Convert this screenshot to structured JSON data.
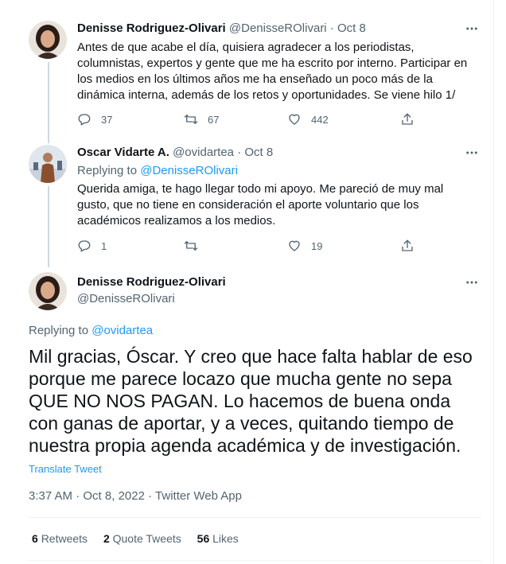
{
  "tweet1": {
    "name": "Denisse Rodriguez-Olivari",
    "handle": "@DenisseROlivari",
    "separator": "·",
    "date": "Oct 8",
    "text": "Antes de que acabe el día, quisiera agradecer a los periodistas, columnistas, expertos y gente que me ha escrito por interno. Participar en los medios en los últimos años me ha enseñado un poco más de la dinámica interna, además de los retos y oportunidades. Se viene hilo 1/",
    "replies": "37",
    "retweets": "67",
    "likes": "442"
  },
  "tweet2": {
    "name": "Oscar Vidarte A.",
    "handle": "@ovidartea",
    "separator": "·",
    "date": "Oct 8",
    "replying_label": "Replying to",
    "replying_handle": "@DenisseROlivari",
    "text": "Querida amiga, te hago llegar todo mi apoyo. Me pareció de muy mal gusto, que no tiene en consideración el aporte voluntario que los académicos realizamos a los medios.",
    "replies": "1",
    "retweets": "",
    "likes": "19"
  },
  "main": {
    "name": "Denisse Rodriguez-Olivari",
    "handle": "@DenisseROlivari",
    "replying_label": "Replying to",
    "replying_handle": "@ovidartea",
    "text": "Mil gracias, Óscar. Y creo que hace falta hablar de eso porque me parece locazo que mucha gente no sepa QUE NO NOS PAGAN. Lo hacemos de buena onda con ganas de aportar, y a veces, quitando tiempo de nuestra propia agenda académica y de investigación.",
    "translate": "Translate Tweet",
    "time": "3:37 AM",
    "date": "Oct 8, 2022",
    "source": "Twitter Web App",
    "separator": "·",
    "retweets_count": "6",
    "retweets_label": "Retweets",
    "quotes_count": "2",
    "quotes_label": "Quote Tweets",
    "likes_count": "56",
    "likes_label": "Likes"
  },
  "icons": {
    "reply": "reply-icon",
    "retweet": "retweet-icon",
    "like": "heart-icon",
    "share": "share-icon",
    "more": "more-icon"
  },
  "colors": {
    "link": "#1d9bf0",
    "muted": "#536471",
    "text": "#0f1419"
  }
}
